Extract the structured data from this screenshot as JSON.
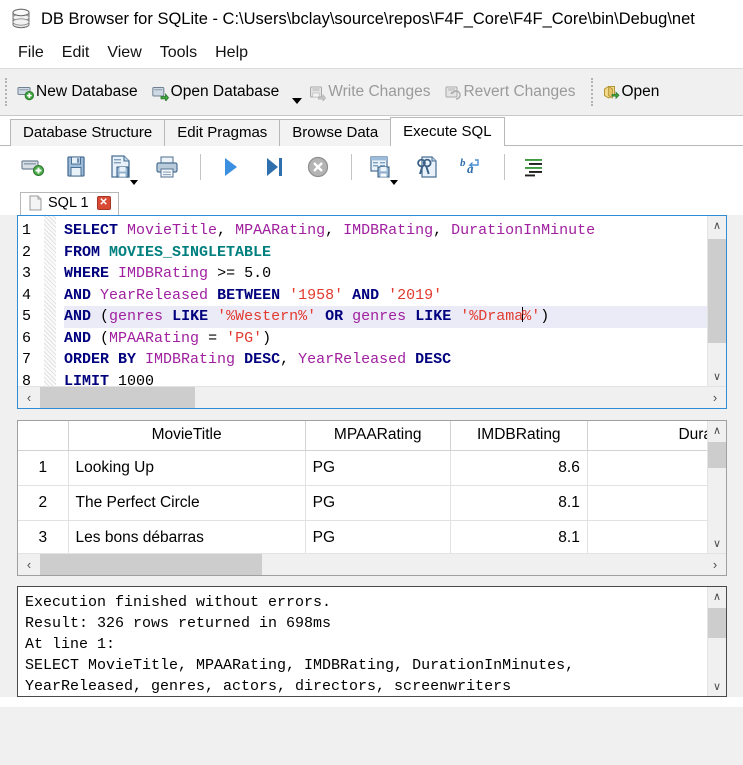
{
  "window": {
    "icon": "database-icon",
    "title": "DB Browser for SQLite - C:\\Users\\bclay\\source\\repos\\F4F_Core\\F4F_Core\\bin\\Debug\\net"
  },
  "menubar": {
    "items": [
      {
        "label": "File"
      },
      {
        "label": "Edit"
      },
      {
        "label": "View"
      },
      {
        "label": "Tools"
      },
      {
        "label": "Help"
      }
    ]
  },
  "toolbar": {
    "buttons": [
      {
        "label": "New Database",
        "icon": "new-database-icon",
        "enabled": true,
        "dropdown": false
      },
      {
        "label": "Open Database",
        "icon": "open-database-icon",
        "enabled": true,
        "dropdown": true
      },
      {
        "label": "Write Changes",
        "icon": "write-changes-icon",
        "enabled": false,
        "dropdown": false
      },
      {
        "label": "Revert Changes",
        "icon": "revert-changes-icon",
        "enabled": false,
        "dropdown": false
      },
      {
        "label": "Open",
        "icon": "open-project-icon",
        "enabled": true,
        "dropdown": false
      }
    ]
  },
  "main_tabs": {
    "items": [
      {
        "label": "Database Structure",
        "active": false
      },
      {
        "label": "Edit Pragmas",
        "active": false
      },
      {
        "label": "Browse Data",
        "active": false
      },
      {
        "label": "Execute SQL",
        "active": true
      }
    ]
  },
  "sql_toolbar": {
    "icons": [
      {
        "name": "open-sql-tab-icon",
        "caret": false
      },
      {
        "name": "open-sql-file-icon",
        "caret": false
      },
      {
        "name": "save-sql-file-icon",
        "caret": true
      },
      {
        "name": "print-icon",
        "caret": false
      },
      {
        "name": "execute-all-icon",
        "caret": false
      },
      {
        "name": "execute-current-line-icon",
        "caret": false
      },
      {
        "name": "stop-execution-icon",
        "caret": false
      },
      {
        "name": "save-results-view-icon",
        "caret": true
      },
      {
        "name": "find-replace-icon",
        "caret": false
      },
      {
        "name": "word-wrap-icon",
        "caret": false
      },
      {
        "name": "format-sql-icon",
        "caret": false
      }
    ]
  },
  "sql_doc_tabs": {
    "items": [
      {
        "label": "SQL 1",
        "icon": "sql-document-icon",
        "close_label": "✕",
        "active": true
      }
    ]
  },
  "editor": {
    "cursor_line": 5,
    "lines": [
      {
        "n": "1",
        "highlight": false,
        "tokens": [
          {
            "t": "SELECT",
            "c": "kw"
          },
          {
            "t": " ",
            "c": "pn"
          },
          {
            "t": "MovieTitle",
            "c": "id"
          },
          {
            "t": ", ",
            "c": "pn"
          },
          {
            "t": "MPAARating",
            "c": "id"
          },
          {
            "t": ", ",
            "c": "pn"
          },
          {
            "t": "IMDBRating",
            "c": "id"
          },
          {
            "t": ", ",
            "c": "pn"
          },
          {
            "t": "DurationInMinute",
            "c": "id"
          }
        ]
      },
      {
        "n": "2",
        "highlight": false,
        "tokens": [
          {
            "t": "FROM",
            "c": "kw"
          },
          {
            "t": " ",
            "c": "pn"
          },
          {
            "t": "MOVIES_SINGLETABLE",
            "c": "tbl"
          }
        ]
      },
      {
        "n": "3",
        "highlight": false,
        "tokens": [
          {
            "t": "WHERE",
            "c": "kw"
          },
          {
            "t": " ",
            "c": "pn"
          },
          {
            "t": "IMDBRating",
            "c": "id"
          },
          {
            "t": " ",
            "c": "pn"
          },
          {
            "t": ">=",
            "c": "op"
          },
          {
            "t": " ",
            "c": "pn"
          },
          {
            "t": "5.0",
            "c": "num"
          }
        ]
      },
      {
        "n": "4",
        "highlight": false,
        "tokens": [
          {
            "t": "AND",
            "c": "kw"
          },
          {
            "t": " ",
            "c": "pn"
          },
          {
            "t": "YearReleased",
            "c": "id"
          },
          {
            "t": " ",
            "c": "pn"
          },
          {
            "t": "BETWEEN",
            "c": "kw"
          },
          {
            "t": " ",
            "c": "pn"
          },
          {
            "t": "'1958'",
            "c": "str"
          },
          {
            "t": " ",
            "c": "pn"
          },
          {
            "t": "AND",
            "c": "kw"
          },
          {
            "t": " ",
            "c": "pn"
          },
          {
            "t": "'2019'",
            "c": "str"
          }
        ]
      },
      {
        "n": "5",
        "highlight": true,
        "tokens": [
          {
            "t": "AND",
            "c": "kw"
          },
          {
            "t": " (",
            "c": "pn"
          },
          {
            "t": "genres",
            "c": "id"
          },
          {
            "t": " ",
            "c": "pn"
          },
          {
            "t": "LIKE",
            "c": "kw"
          },
          {
            "t": " ",
            "c": "pn"
          },
          {
            "t": "'%Western%'",
            "c": "str"
          },
          {
            "t": " ",
            "c": "pn"
          },
          {
            "t": "OR",
            "c": "kw"
          },
          {
            "t": " ",
            "c": "pn"
          },
          {
            "t": "genres",
            "c": "id"
          },
          {
            "t": " ",
            "c": "pn"
          },
          {
            "t": "LIKE",
            "c": "kw"
          },
          {
            "t": " ",
            "c": "pn"
          },
          {
            "t": "'%Drama",
            "c": "str"
          },
          {
            "t": "|CARET|",
            "c": "caret"
          },
          {
            "t": "%'",
            "c": "str"
          },
          {
            "t": ")",
            "c": "pn"
          }
        ]
      },
      {
        "n": "6",
        "highlight": false,
        "tokens": [
          {
            "t": "AND",
            "c": "kw"
          },
          {
            "t": " (",
            "c": "pn"
          },
          {
            "t": "MPAARating",
            "c": "id"
          },
          {
            "t": " ",
            "c": "pn"
          },
          {
            "t": "=",
            "c": "op"
          },
          {
            "t": " ",
            "c": "pn"
          },
          {
            "t": "'PG'",
            "c": "str"
          },
          {
            "t": ")",
            "c": "pn"
          }
        ]
      },
      {
        "n": "7",
        "highlight": false,
        "tokens": [
          {
            "t": "ORDER BY",
            "c": "kw"
          },
          {
            "t": " ",
            "c": "pn"
          },
          {
            "t": "IMDBRating",
            "c": "id"
          },
          {
            "t": " ",
            "c": "pn"
          },
          {
            "t": "DESC",
            "c": "kw"
          },
          {
            "t": ", ",
            "c": "pn"
          },
          {
            "t": "YearReleased",
            "c": "id"
          },
          {
            "t": " ",
            "c": "pn"
          },
          {
            "t": "DESC",
            "c": "kw"
          }
        ]
      },
      {
        "n": "8",
        "highlight": false,
        "tokens": [
          {
            "t": "LIMIT",
            "c": "kw"
          },
          {
            "t": " ",
            "c": "pn"
          },
          {
            "t": "1000",
            "c": "num"
          }
        ]
      }
    ],
    "scroll": {
      "v_up": "∧",
      "v_down": "∨",
      "h_left": "‹",
      "h_right": "›"
    }
  },
  "results": {
    "columns": [
      "",
      "MovieTitle",
      "MPAARating",
      "IMDBRating",
      "Durat"
    ],
    "rows": [
      {
        "n": "1",
        "MovieTitle": "Looking Up",
        "MPAARating": "PG",
        "IMDBRating": "8.6",
        "Duration": ""
      },
      {
        "n": "2",
        "MovieTitle": "The Perfect Circle",
        "MPAARating": "PG",
        "IMDBRating": "8.1",
        "Duration": ""
      },
      {
        "n": "3",
        "MovieTitle": "Les bons débarras",
        "MPAARating": "PG",
        "IMDBRating": "8.1",
        "Duration": ""
      }
    ],
    "scroll": {
      "v_up": "∧",
      "v_down": "∨",
      "h_left": "‹",
      "h_right": "›"
    }
  },
  "log": {
    "text": "Execution finished without errors.\nResult: 326 rows returned in 698ms\nAt line 1:\nSELECT MovieTitle, MPAARating, IMDBRating, DurationInMinutes,\nYearReleased, genres, actors, directors, screenwriters",
    "scroll": {
      "v_up": "∧",
      "v_down": "∨"
    }
  },
  "colors": {
    "keyword": "#00007f",
    "identifier": "#a020a0",
    "table": "#007f7f",
    "string": "#e23a2e",
    "editor_border": "#2e8bd4",
    "selection": "#ebebf7"
  }
}
